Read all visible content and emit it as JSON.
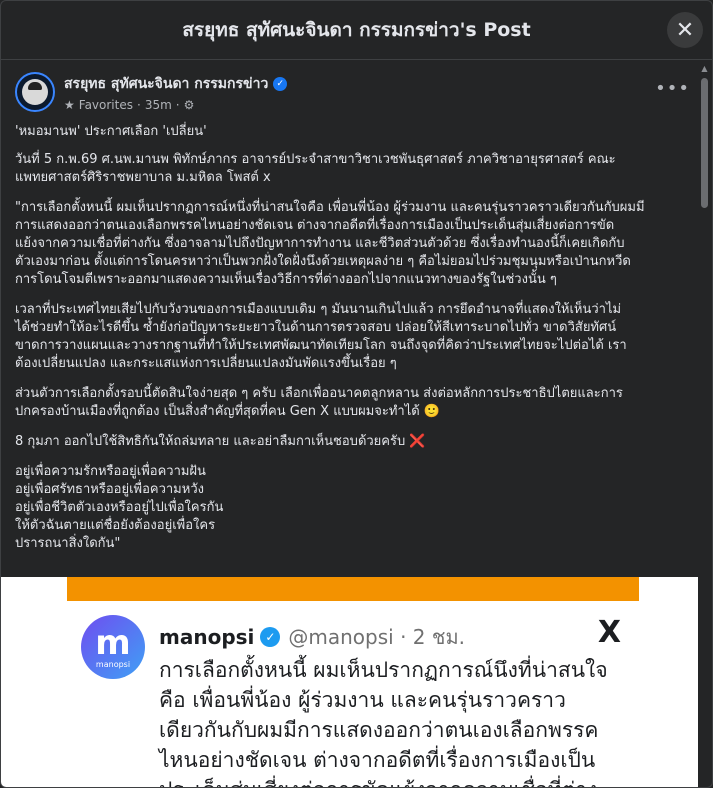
{
  "header": {
    "title": "สรยุทธ สุทัศนะจินดา กรรมกรข่าว's Post",
    "close_icon": "close-icon"
  },
  "post": {
    "author": "สรยุทธ สุทัศนะจินดา กรรมกรข่าว",
    "favorites_label": "Favorites",
    "time": "35m",
    "audience_icon": "gear-icon",
    "more_icon": "more-options-icon",
    "paragraphs": [
      "'หมอมานพ' ประกาศเลือก 'เปลี่ยน'",
      "วันที่ 5 ก.พ.69 ศ.นพ.มานพ พิทักษ์ภากร อาจารย์ประจำสาขาวิชาเวชพันธุศาสตร์ ภาควิชาอายุรศาสตร์ คณะ\nแพทยศาสตร์ศิริราชพยาบาล ม.มหิดล โพสต์ x",
      "\"การเลือกตั้งหนนี้ ผมเห็นปรากฏการณ์หนึ่งที่น่าสนใจคือ เพื่อนพี่น้อง ผู้ร่วมงาน และคนรุ่นราวคราวเดียวกันกับผมมี\nการแสดงออกว่าตนเองเลือกพรรคไหนอย่างชัดเจน ต่างจากอดีตที่เรื่องการเมืองเป็นประเด็นสุ่มเสี่ยงต่อการขัด\nแย้งจากความเชื่อที่ต่างกัน ซึ่งอาจลามไปถึงปัญหาการทำงาน และชีวิตส่วนตัวด้วย ซึ่งเรื่องทำนองนี้ก็เคยเกิดกับ\nตัวเองมาก่อน ตั้งแต่การโดนครหาว่าเป็นพวกฝั่งใดฝั่งนึงด้วยเหตุผลง่าย ๆ คือไม่ยอมไปร่วมชุมนุมหรือเป่านกหวีด\nการโดนโจมตีเพราะออกมาแสดงความเห็นเรื่องวิธีการที่ต่างออกไปจากแนวทางของรัฐในช่วงนั้น ๆ",
      "เวลาที่ประเทศไทยเสียไปกับวังวนของการเมืองแบบเดิม ๆ มันนานเกินไปแล้ว การยึดอำนาจที่แสดงให้เห็นว่าไม่\nได้ช่วยทำให้อะไรดีขึ้น ซ้ำยังก่อปัญหาระยะยาวในด้านการตรวจสอบ ปล่อยให้สีเทาระบาดไปทั่ว ขาดวิสัยทัศน์\nขาดการวางแผนและวางรากฐานที่ทำให้ประเทศพัฒนาทัดเทียมโลก จนถึงจุดที่คิดว่าประเทศไทยจะไปต่อได้ เรา\nต้องเปลี่ยนแปลง และกระแสแห่งการเปลี่ยนแปลงมันพัดแรงขึ้นเรื่อย ๆ",
      "ส่วนตัวการเลือกตั้งรอบนี้ตัดสินใจง่ายสุด ๆ ครับ เลือกเพื่ออนาคตลูกหลาน ส่งต่อหลักการประชาธิปไตยและการ\nปกครองบ้านเมืองที่ถูกต้อง เป็นสิ่งสำคัญที่สุดที่คน Gen X แบบผมจะทำได้ 🙂",
      "8 กุมภา ออกไปใช้สิทธิกันให้ถล่มทลาย และอย่าลืมกาเห็นชอบด้วยครับ ❌",
      "อยู่เพื่อความรักหรืออยู่เพื่อความฝัน\nอยู่เพื่อศรัทธาหรืออยู่เพื่อความหวัง\nอยู่เพื่อชีวิตตัวเองหรืออยู่ไปเพื่อใครกัน\nให้ตัวฉันตายแต่ชื่อยังต้องอยู่เพื่อใคร\nปรารถนาสิ่งใดกัน\""
    ]
  },
  "embedded_tweet": {
    "logo_letter": "m",
    "logo_caption": "manopsi",
    "name": "manopsi",
    "handle": "@manopsi · 2 ชม.",
    "x_logo": "X",
    "text": "การเลือกตั้งหนนี้ ผมเห็นปรากฏการณ์นึงที่น่าสนใจ\nคือ เพื่อนพี่น้อง ผู้ร่วมงาน และคนรุ่นราวคราว\nเดียวกันกับผมมีการแสดงออกว่าตนเองเลือกพรรค\nไหนอย่างชัดเจน ต่างจากอดีตที่เรื่องการเมืองเป็น\nประเด็นสุ่มเสี่ยงต่อการขัดแย้งจากความเชื่อที่ต่าง"
  },
  "colors": {
    "background": "#242526",
    "accent_orange": "#f39200",
    "verified_blue": "#1877f2"
  }
}
